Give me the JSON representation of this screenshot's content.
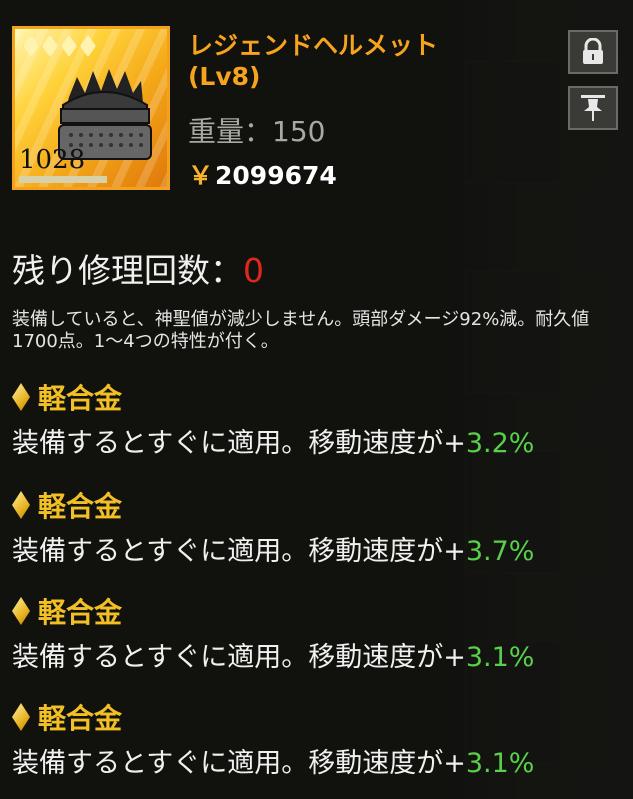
{
  "item": {
    "name": "レジェンドヘルメット",
    "level": "(Lv8)",
    "weight_label": "重量：",
    "weight_value": "150",
    "price_symbol": "￥",
    "price_value": "2099674",
    "icon_number": "1028",
    "stars": 4
  },
  "repair": {
    "label": "残り修理回数：",
    "value": "0"
  },
  "description": "装備していると、神聖値が減少しません。頭部ダメージ92%減。耐久値1700点。1～4つの特性が付く。",
  "traits": [
    {
      "title": "軽合金",
      "text": "装備するとすぐに適用。移動速度が+",
      "value": "3.2%"
    },
    {
      "title": "軽合金",
      "text": "装備するとすぐに適用。移動速度が+",
      "value": "3.7%"
    },
    {
      "title": "軽合金",
      "text": "装備するとすぐに適用。移動速度が+",
      "value": "3.1%"
    },
    {
      "title": "軽合金",
      "text": "装備するとすぐに適用。移動速度が+",
      "value": "3.1%"
    }
  ],
  "colors": {
    "name": "#f6a31e",
    "trait_title": "#f2c024",
    "trait_value": "#58d04a",
    "repair_value": "#e2281c"
  },
  "icons": [
    "lock-icon",
    "pin-icon",
    "diamond-icon",
    "star-icon",
    "helmet-icon"
  ]
}
